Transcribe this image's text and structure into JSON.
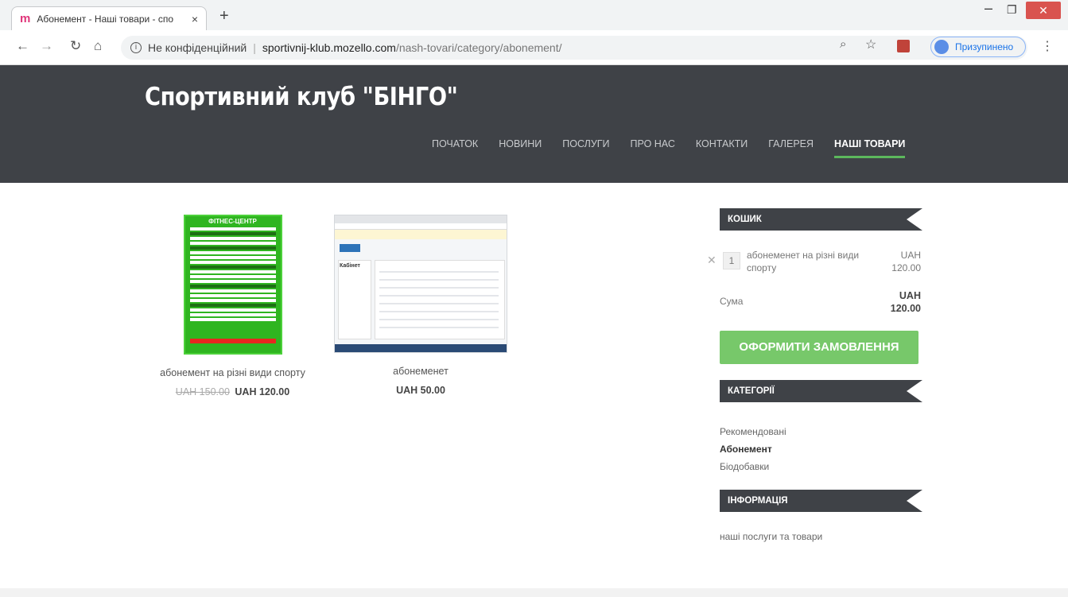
{
  "browser": {
    "tab_title": "Абонемент - Наші товари - спо",
    "tab_close": "×",
    "new_tab": "+",
    "security_label": "Не конфіденційний",
    "url_host": "sportivnij-klub.mozello.com",
    "url_path": "/nash-tovari/category/abonement/",
    "profile_label": "Призупинено"
  },
  "site": {
    "title": "Спортивний клуб \"БІНГО\"",
    "nav": [
      {
        "label": "ПОЧАТОК"
      },
      {
        "label": "НОВИНИ"
      },
      {
        "label": "ПОСЛУГИ"
      },
      {
        "label": "ПРО НАС"
      },
      {
        "label": "КОНТАКТИ"
      },
      {
        "label": "ГАЛЕРЕЯ"
      },
      {
        "label": "НАШІ ТОВАРИ",
        "active": true
      }
    ],
    "accent_color": "#5cb85c",
    "header_bg": "#3f4247"
  },
  "products": [
    {
      "name": "абонемент на різні види спорту",
      "old_price": "UAH 150.00",
      "price": "UAH 120.00",
      "image_heading": "ФІТНЕС-ЦЕНТР"
    },
    {
      "name": "абонеменет",
      "price": "UAH 50.00",
      "image_heading": "Кабінет"
    }
  ],
  "sidebar": {
    "cart": {
      "title": "КОШИК",
      "items": [
        {
          "qty": "1",
          "name": "абонеменет на різні види спорту",
          "price_currency": "UAH",
          "price_amount": "120.00"
        }
      ],
      "sum_label": "Сума",
      "sum_currency": "UAH",
      "sum_amount": "120.00",
      "checkout_label": "ОФОРМИТИ ЗАМОВЛЕННЯ"
    },
    "categories": {
      "title": "КАТЕГОРІЇ",
      "items": [
        {
          "label": "Рекомендовані"
        },
        {
          "label": "Абонемент",
          "active": true
        },
        {
          "label": "Біодобавки"
        }
      ]
    },
    "info": {
      "title": "ІНФОРМАЦІЯ",
      "link": "наші послуги та товари"
    }
  }
}
